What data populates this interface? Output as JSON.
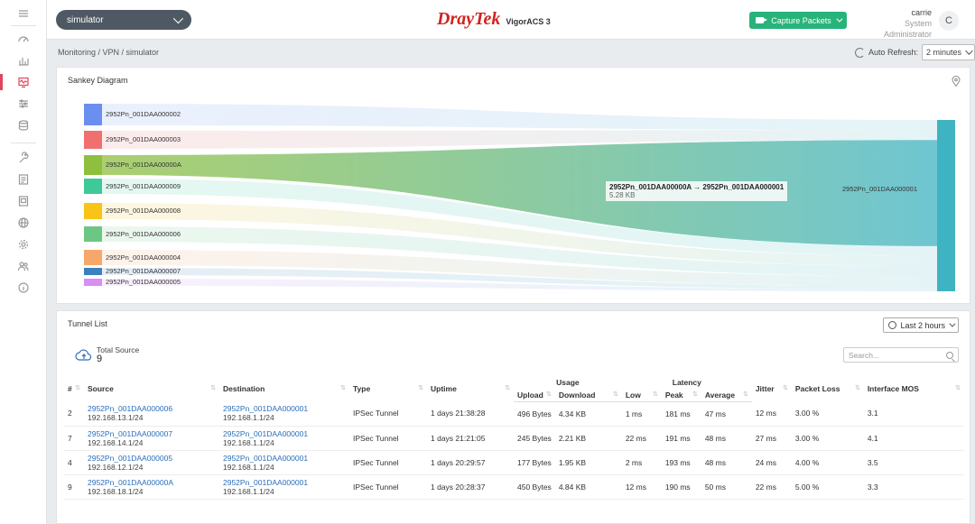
{
  "topbar": {
    "device": "simulator",
    "brand": "DrayTek",
    "product": "VigorACS 3",
    "capture_label": "Capture Packets",
    "user_name": "carrie",
    "user_role": "System Administrator",
    "avatar_initial": "C"
  },
  "breadcrumb": "Monitoring / VPN / simulator",
  "refresh": {
    "label": "Auto Refresh:",
    "value": "2 minutes"
  },
  "sidebar": {
    "items": [
      "dashboard-icon",
      "chart-icon",
      "monitor-icon",
      "sliders-icon",
      "database-icon",
      "wrench-icon",
      "report-icon",
      "server-icon",
      "globe-icon",
      "gear-icon",
      "users-icon",
      "info-icon"
    ],
    "active_index": 2,
    "accent": "#e0455a"
  },
  "sankey": {
    "title": "Sankey Diagram",
    "sources": [
      {
        "name": "2952Pn_001DAA000002",
        "color": "#6b8ff0",
        "value": 0.5
      },
      {
        "name": "2952Pn_001DAA000003",
        "color": "#f07070",
        "value": 0.5
      },
      {
        "name": "2952Pn_001DAA00000A",
        "color": "#8fbf3f",
        "value": 5.28
      },
      {
        "name": "2952Pn_001DAA000009",
        "color": "#3ec998",
        "value": 0.5
      },
      {
        "name": "2952Pn_001DAA000008",
        "color": "#f7c417",
        "value": 0.5
      },
      {
        "name": "2952Pn_001DAA000006",
        "color": "#6cc784",
        "value": 0.5
      },
      {
        "name": "2952Pn_001DAA000004",
        "color": "#f6a86a",
        "value": 0.5
      },
      {
        "name": "2952Pn_001DAA000007",
        "color": "#3b82bd",
        "value": 0.15
      },
      {
        "name": "2952Pn_001DAA000005",
        "color": "#d88ef5",
        "value": 0.1
      }
    ],
    "target": {
      "name": "2952Pn_001DAA000001",
      "color": "#3fb3c2"
    },
    "tooltip": {
      "title": "2952Pn_001DAA00000A → 2952Pn_001DAA000001",
      "value": "5.28 KB"
    }
  },
  "tunnels": {
    "title": "Tunnel List",
    "time_range": "Last 2 hours",
    "total_label": "Total Source",
    "total_count": "9",
    "search_placeholder": "Search...",
    "group_headers": {
      "usage": "Usage",
      "latency": "Latency"
    },
    "columns": {
      "num": "#",
      "source": "Source",
      "destination": "Destination",
      "type": "Type",
      "uptime": "Uptime",
      "upload": "Upload",
      "download": "Download",
      "low": "Low",
      "peak": "Peak",
      "average": "Average",
      "jitter": "Jitter",
      "packet_loss": "Packet Loss",
      "mos": "Interface MOS"
    },
    "rows": [
      {
        "num": "2",
        "src": "2952Pn_001DAA000006",
        "src_ip": "192.168.13.1/24",
        "dst": "2952Pn_001DAA000001",
        "dst_ip": "192.168.1.1/24",
        "type": "IPSec Tunnel",
        "uptime": "1 days 21:38:28",
        "upload": "496 Bytes",
        "download": "4.34 KB",
        "low": "1 ms",
        "peak": "181 ms",
        "avg": "47 ms",
        "jitter": "12 ms",
        "loss": "3.00 %",
        "mos": "3.1"
      },
      {
        "num": "7",
        "src": "2952Pn_001DAA000007",
        "src_ip": "192.168.14.1/24",
        "dst": "2952Pn_001DAA000001",
        "dst_ip": "192.168.1.1/24",
        "type": "IPSec Tunnel",
        "uptime": "1 days 21:21:05",
        "upload": "245 Bytes",
        "download": "2.21 KB",
        "low": "22 ms",
        "peak": "191 ms",
        "avg": "48 ms",
        "jitter": "27 ms",
        "loss": "3.00 %",
        "mos": "4.1"
      },
      {
        "num": "4",
        "src": "2952Pn_001DAA000005",
        "src_ip": "192.168.12.1/24",
        "dst": "2952Pn_001DAA000001",
        "dst_ip": "192.168.1.1/24",
        "type": "IPSec Tunnel",
        "uptime": "1 days 20:29:57",
        "upload": "177 Bytes",
        "download": "1.95 KB",
        "low": "2 ms",
        "peak": "193 ms",
        "avg": "48 ms",
        "jitter": "24 ms",
        "loss": "4.00 %",
        "mos": "3.5"
      },
      {
        "num": "9",
        "src": "2952Pn_001DAA00000A",
        "src_ip": "192.168.18.1/24",
        "dst": "2952Pn_001DAA000001",
        "dst_ip": "192.168.1.1/24",
        "type": "IPSec Tunnel",
        "uptime": "1 days 20:28:37",
        "upload": "450 Bytes",
        "download": "4.84 KB",
        "low": "12 ms",
        "peak": "190 ms",
        "avg": "50 ms",
        "jitter": "22 ms",
        "loss": "5.00 %",
        "mos": "3.3"
      }
    ]
  }
}
